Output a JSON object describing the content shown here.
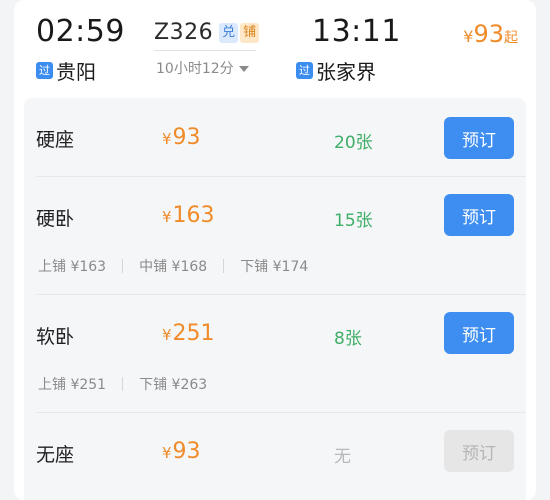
{
  "header": {
    "departure_time": "02:59",
    "departure_station": "贵阳",
    "departure_tag": "过",
    "train_number": "Z326",
    "tags": [
      "兑",
      "铺"
    ],
    "duration": "10小时12分",
    "arrival_time": "13:11",
    "arrival_station": "张家界",
    "arrival_tag": "过",
    "min_price_symbol": "¥",
    "min_price_value": "93",
    "min_price_suffix": "起"
  },
  "seats": [
    {
      "name": "硬座",
      "price_symbol": "¥",
      "price": "93",
      "availability": "20张",
      "button": "预订",
      "berths": []
    },
    {
      "name": "硬卧",
      "price_symbol": "¥",
      "price": "163",
      "availability": "15张",
      "button": "预订",
      "berths": [
        "上铺 ¥163",
        "中铺 ¥168",
        "下铺 ¥174"
      ]
    },
    {
      "name": "软卧",
      "price_symbol": "¥",
      "price": "251",
      "availability": "8张",
      "button": "预订",
      "berths": [
        "上铺 ¥251",
        "下铺 ¥263"
      ]
    },
    {
      "name": "无座",
      "price_symbol": "¥",
      "price": "93",
      "availability": "无",
      "button": "预订",
      "berths": []
    }
  ],
  "colors": {
    "accent_blue": "#3d8ef0",
    "price_orange": "#f08b2a",
    "available_green": "#3fae66",
    "disabled_gray": "#e6e6e6"
  }
}
